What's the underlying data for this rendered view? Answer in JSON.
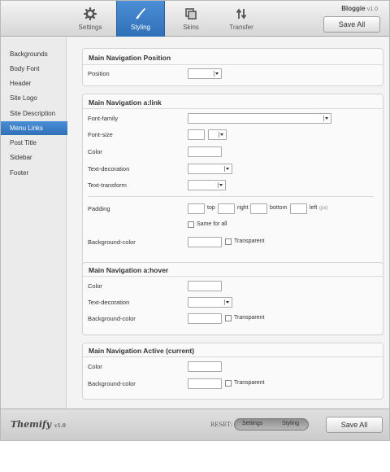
{
  "header": {
    "tabs": [
      {
        "label": "Settings",
        "icon": "gear-icon"
      },
      {
        "label": "Styling",
        "icon": "brush-icon"
      },
      {
        "label": "Skins",
        "icon": "layers-icon"
      },
      {
        "label": "Transfer",
        "icon": "arrows-icon"
      }
    ],
    "active_tab": "Styling",
    "brand": "Bloggie",
    "brand_version": "v1.0",
    "save_label": "Save All"
  },
  "sidebar": {
    "items": [
      "Backgrounds",
      "Body Font",
      "Header",
      "Site Logo",
      "Site Description",
      "Menu Links",
      "Post Title",
      "Sidebar",
      "Footer"
    ],
    "active": "Menu Links"
  },
  "sections": {
    "position": {
      "title": "Main Navigation Position",
      "position_label": "Position"
    },
    "link": {
      "title": "Main Navigation a:link",
      "font_family": "Font-family",
      "font_size": "Font-size",
      "color": "Color",
      "text_decoration": "Text-decoration",
      "text_transform": "Text-transform",
      "padding": "Padding",
      "top": "top",
      "right": "right",
      "bottom": "bottom",
      "left": "left",
      "unit": "(px)",
      "same_for_all": "Same for all",
      "bg_color": "Background-color",
      "transparent": "Transparent"
    },
    "hover": {
      "title": "Main Navigation a:hover",
      "color": "Color",
      "text_decoration": "Text-decoration",
      "bg_color": "Background-color",
      "transparent": "Transparent"
    },
    "active": {
      "title": "Main Navigation Active (current)",
      "color": "Color",
      "bg_color": "Background-color",
      "transparent": "Transparent"
    }
  },
  "footer": {
    "logo": "Themify",
    "logo_version": "v1.0",
    "reset_label": "RESET:",
    "reset_settings": "Settings",
    "reset_styling": "Styling",
    "save_label": "Save All"
  },
  "colors": {
    "accent": "#3a7bc8",
    "background": "#f3f3f3"
  }
}
